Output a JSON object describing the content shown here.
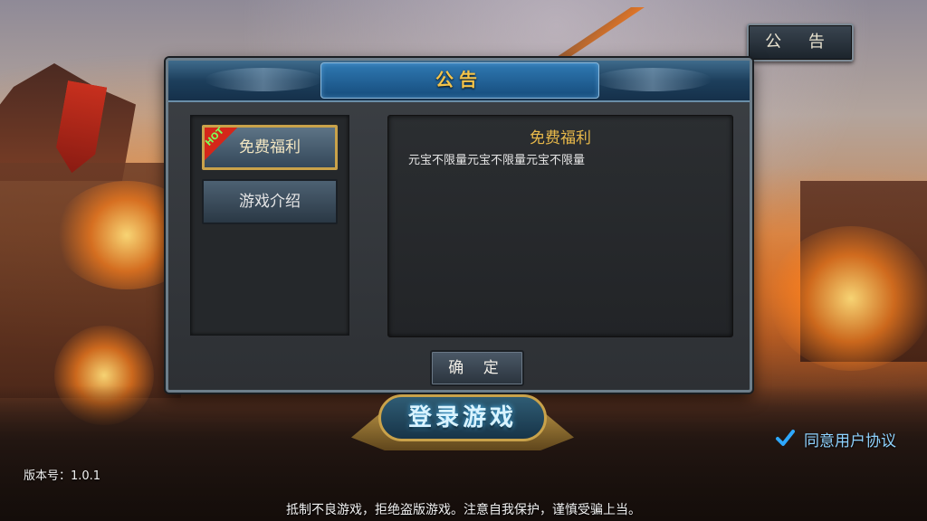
{
  "top_notice_button": "公 告",
  "dialog": {
    "title": "公告",
    "tabs": [
      {
        "label": "免费福利",
        "badge": "HOT",
        "active": true
      },
      {
        "label": "游戏介绍",
        "active": false
      }
    ],
    "content": {
      "title": "免费福利",
      "body": "元宝不限量元宝不限量元宝不限量"
    },
    "confirm_label": "确 定"
  },
  "login_button": "登录游戏",
  "agreement": {
    "label": "同意用户协议",
    "checked": true
  },
  "version": "版本号：1.0.1",
  "warning": "抵制不良游戏，拒绝盗版游戏。注意自我保护，谨慎受骗上当。",
  "colors": {
    "accent_gold": "#e9b94a",
    "header_blue": "#1d3f5c",
    "agreement_blue": "#8fd3ff"
  }
}
